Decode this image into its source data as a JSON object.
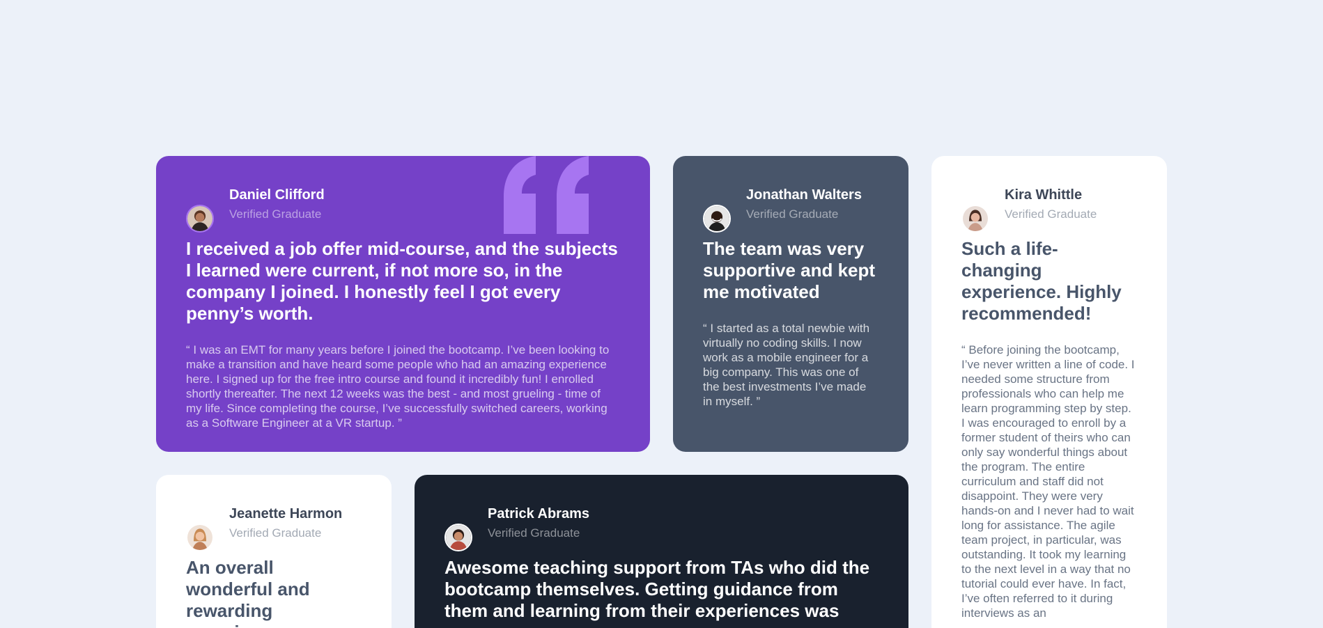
{
  "colors": {
    "background": "#ecf1f9",
    "purple": "#7541c8",
    "gray": "#48556a",
    "white": "#ffffff",
    "dark": "#19212e",
    "quote_mark": "#a775f1"
  },
  "testimonials": [
    {
      "name": "Daniel Clifford",
      "role": "Verified Graduate",
      "headline": "I received a job offer mid-course, and the subjects I learned were current, if not more so, in the company I joined. I honestly feel I got every penny’s worth.",
      "body": "“ I was an EMT for many years before I joined the bootcamp. I’ve been looking to make a transition and have heard some people who had an amazing experience here. I signed up for the free intro course and found it incredibly fun! I enrolled shortly thereafter. The next 12 weeks was the best - and most grueling - time of my life. Since completing the course, I’ve successfully switched careers, working as a Software Engineer at a VR startup. ”",
      "avatar_icon": "man-avatar-icon"
    },
    {
      "name": "Jonathan Walters",
      "role": "Verified Graduate",
      "headline": "The team was very supportive and kept me motivated",
      "body": "“ I started as a total newbie with virtually no coding skills. I now work as a mobile engineer for a big company. This was one of the best investments I’ve made in myself. ”",
      "avatar_icon": "man-avatar-icon"
    },
    {
      "name": "Kira Whittle",
      "role": "Verified Graduate",
      "headline": "Such a life-changing experience. Highly recommended!",
      "body": "“ Before joining the bootcamp, I’ve never written a line of code. I needed some structure from professionals who can help me learn programming step by step. I was encouraged to enroll by a former student of theirs who can only say wonderful things about the program. The entire curriculum and staff did not disappoint. They were very hands-on and I never had to wait long for assistance. The agile team project, in particular, was outstanding. It took my learning to the next level in a way that no tutorial could ever have. In fact, I’ve often referred to it during interviews as an",
      "avatar_icon": "woman-avatar-icon"
    },
    {
      "name": "Jeanette Harmon",
      "role": "Verified Graduate",
      "headline": "An overall wonderful and rewarding experience",
      "body": "",
      "avatar_icon": "woman-avatar-icon"
    },
    {
      "name": "Patrick Abrams",
      "role": "Verified Graduate",
      "headline": "Awesome teaching support from TAs who did the bootcamp themselves. Getting guidance from them and learning from their experiences was easy.",
      "body": "",
      "avatar_icon": "man-avatar-icon"
    }
  ]
}
